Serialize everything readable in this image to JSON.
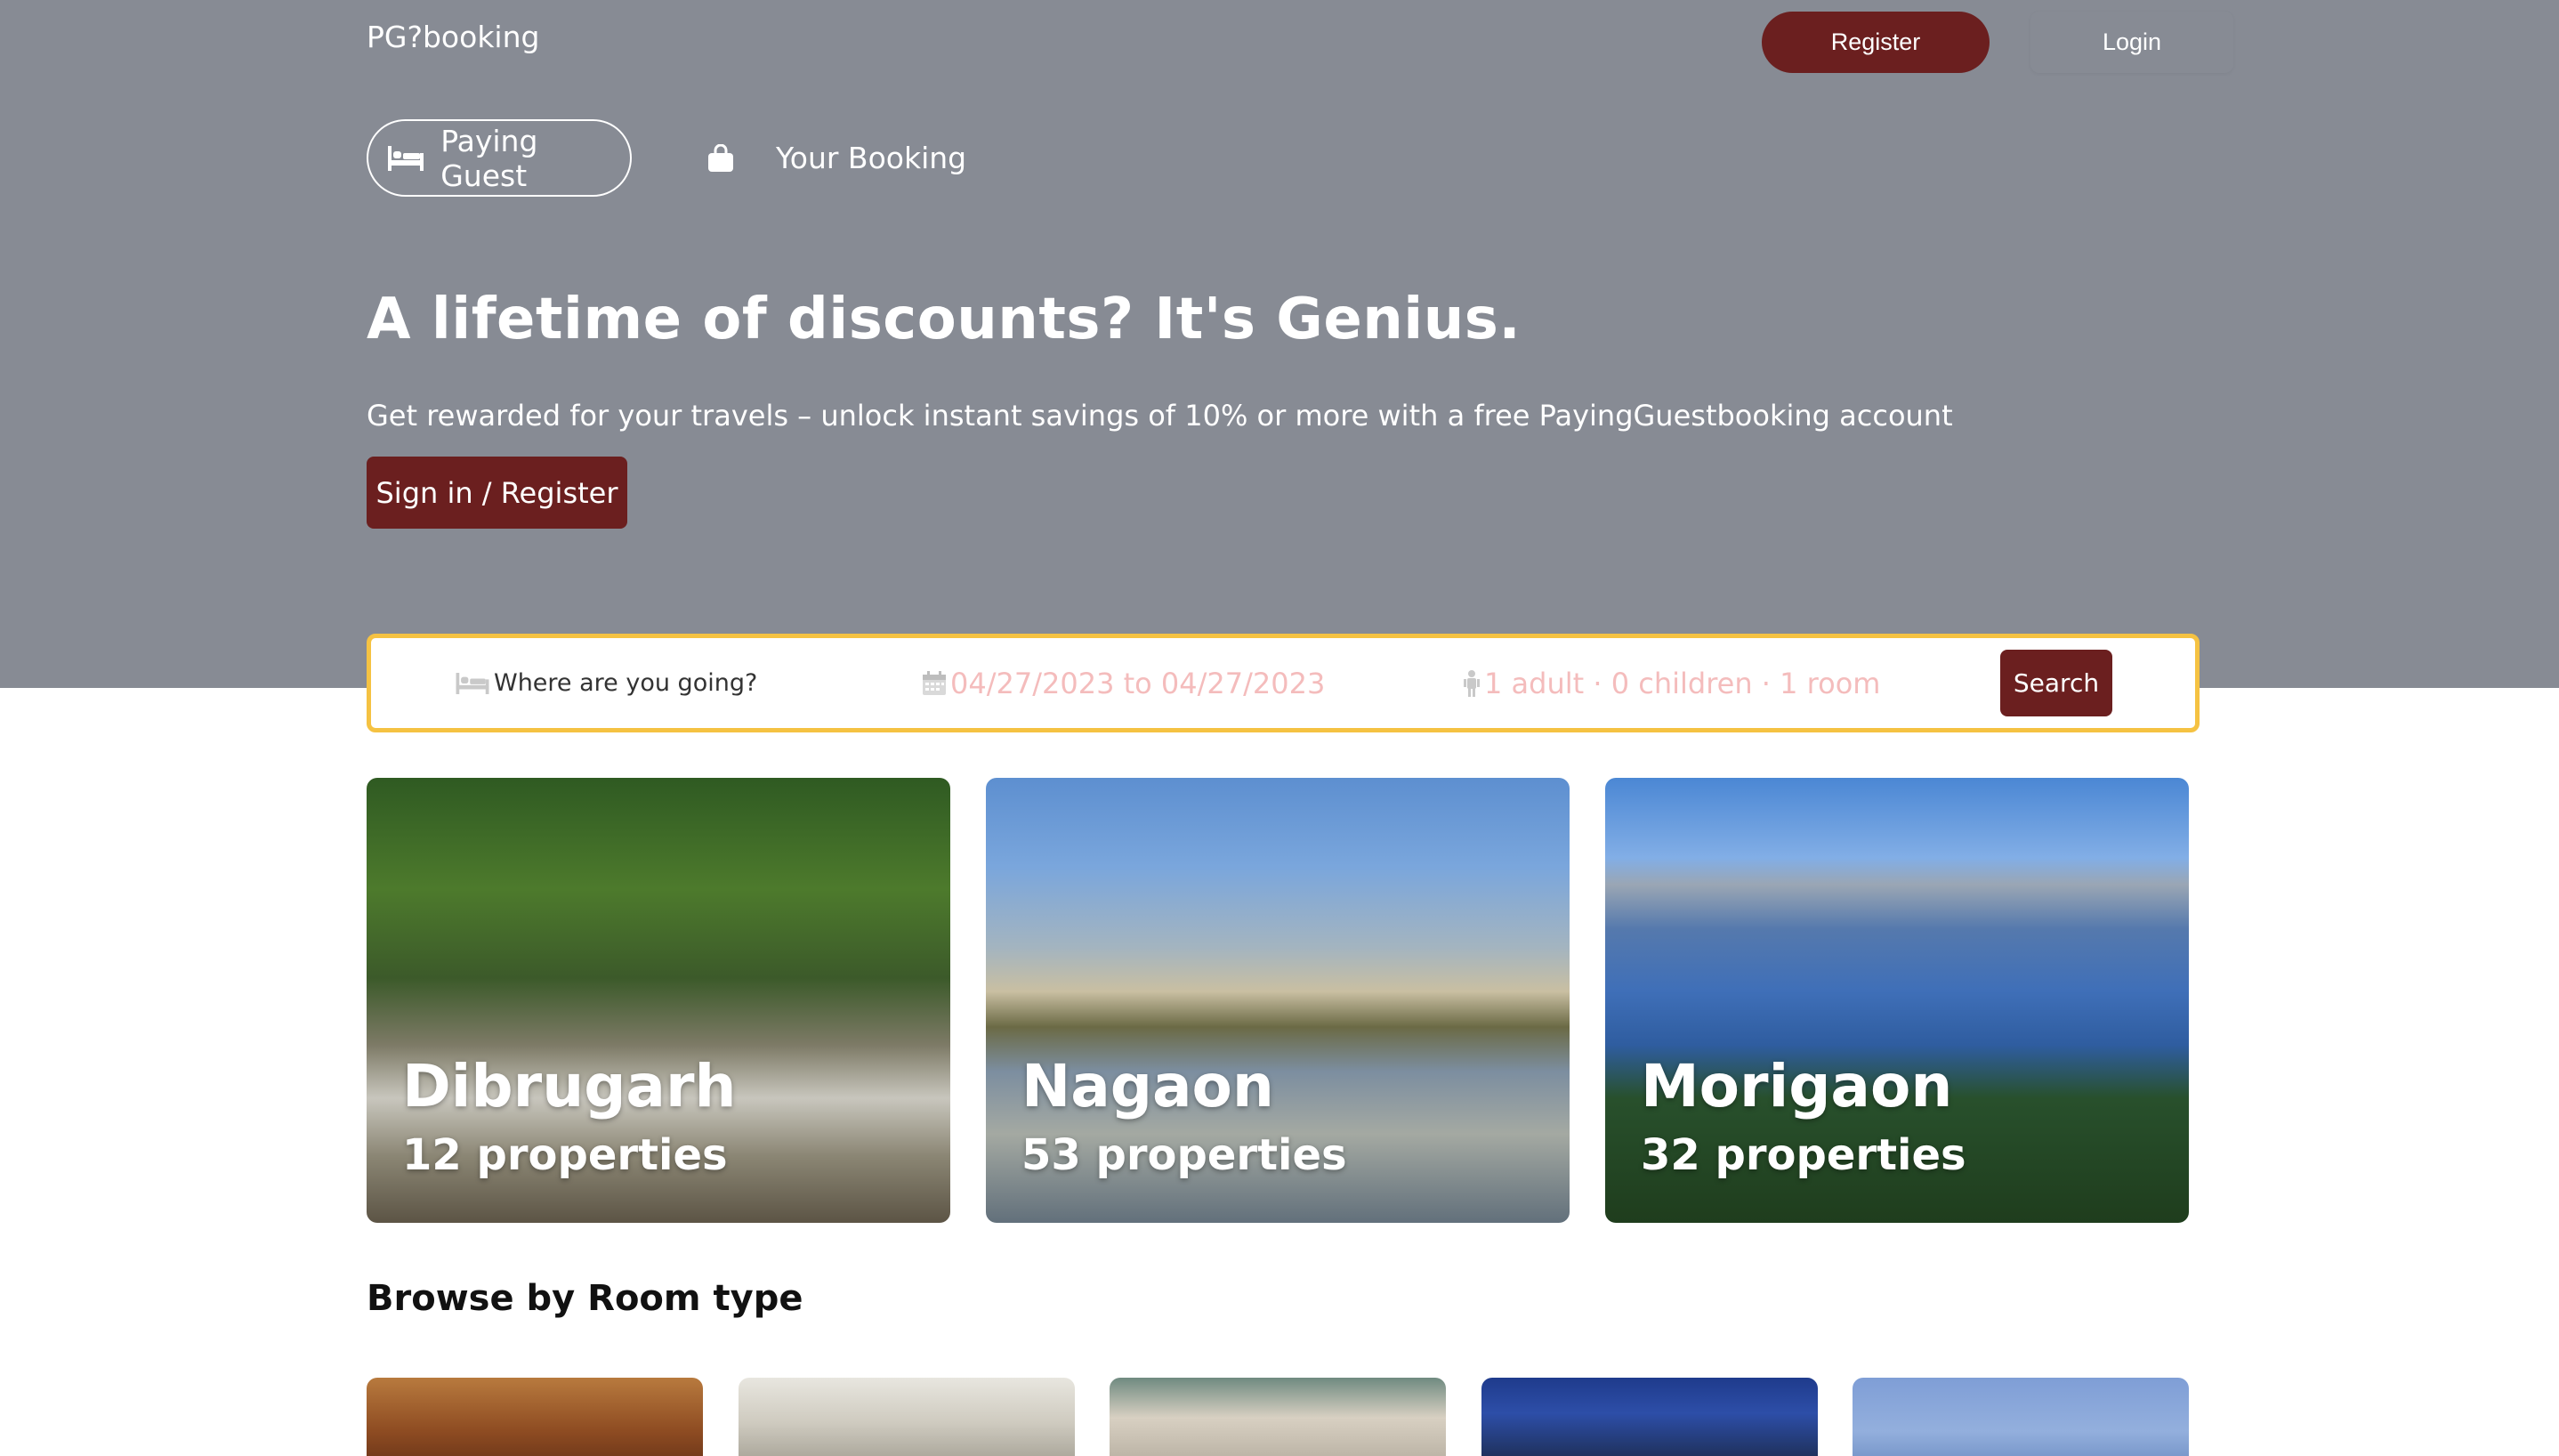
{
  "header": {
    "logo": "PG?booking",
    "register_label": "Register",
    "login_label": "Login"
  },
  "tabs": [
    {
      "label": "Paying Guest",
      "icon": "bed-icon",
      "active": true
    },
    {
      "label": "Your Booking",
      "icon": "shopping-bag-icon",
      "active": false
    }
  ],
  "hero": {
    "title": "A lifetime of discounts? It's Genius.",
    "subtitle": "Get rewarded for your travels – unlock instant savings of 10% or more with a free PayingGuestbooking account",
    "signin_label": "Sign in / Register"
  },
  "search": {
    "destination_placeholder": "Where are you going?",
    "dates": "04/27/2023 to 04/27/2023",
    "occupancy": "1 adult · 0 children · 1 room",
    "search_label": "Search"
  },
  "cities": [
    {
      "name": "Dibrugarh",
      "count": "12 properties"
    },
    {
      "name": "Nagaon",
      "count": "53 properties"
    },
    {
      "name": "Morigaon",
      "count": "32 properties"
    }
  ],
  "browse": {
    "title": "Browse by Room type"
  },
  "colors": {
    "hero_bg": "#878b94",
    "brand": "#6b1f1f",
    "search_border": "#f5c242",
    "muted_placeholder": "#f4bcbc"
  }
}
